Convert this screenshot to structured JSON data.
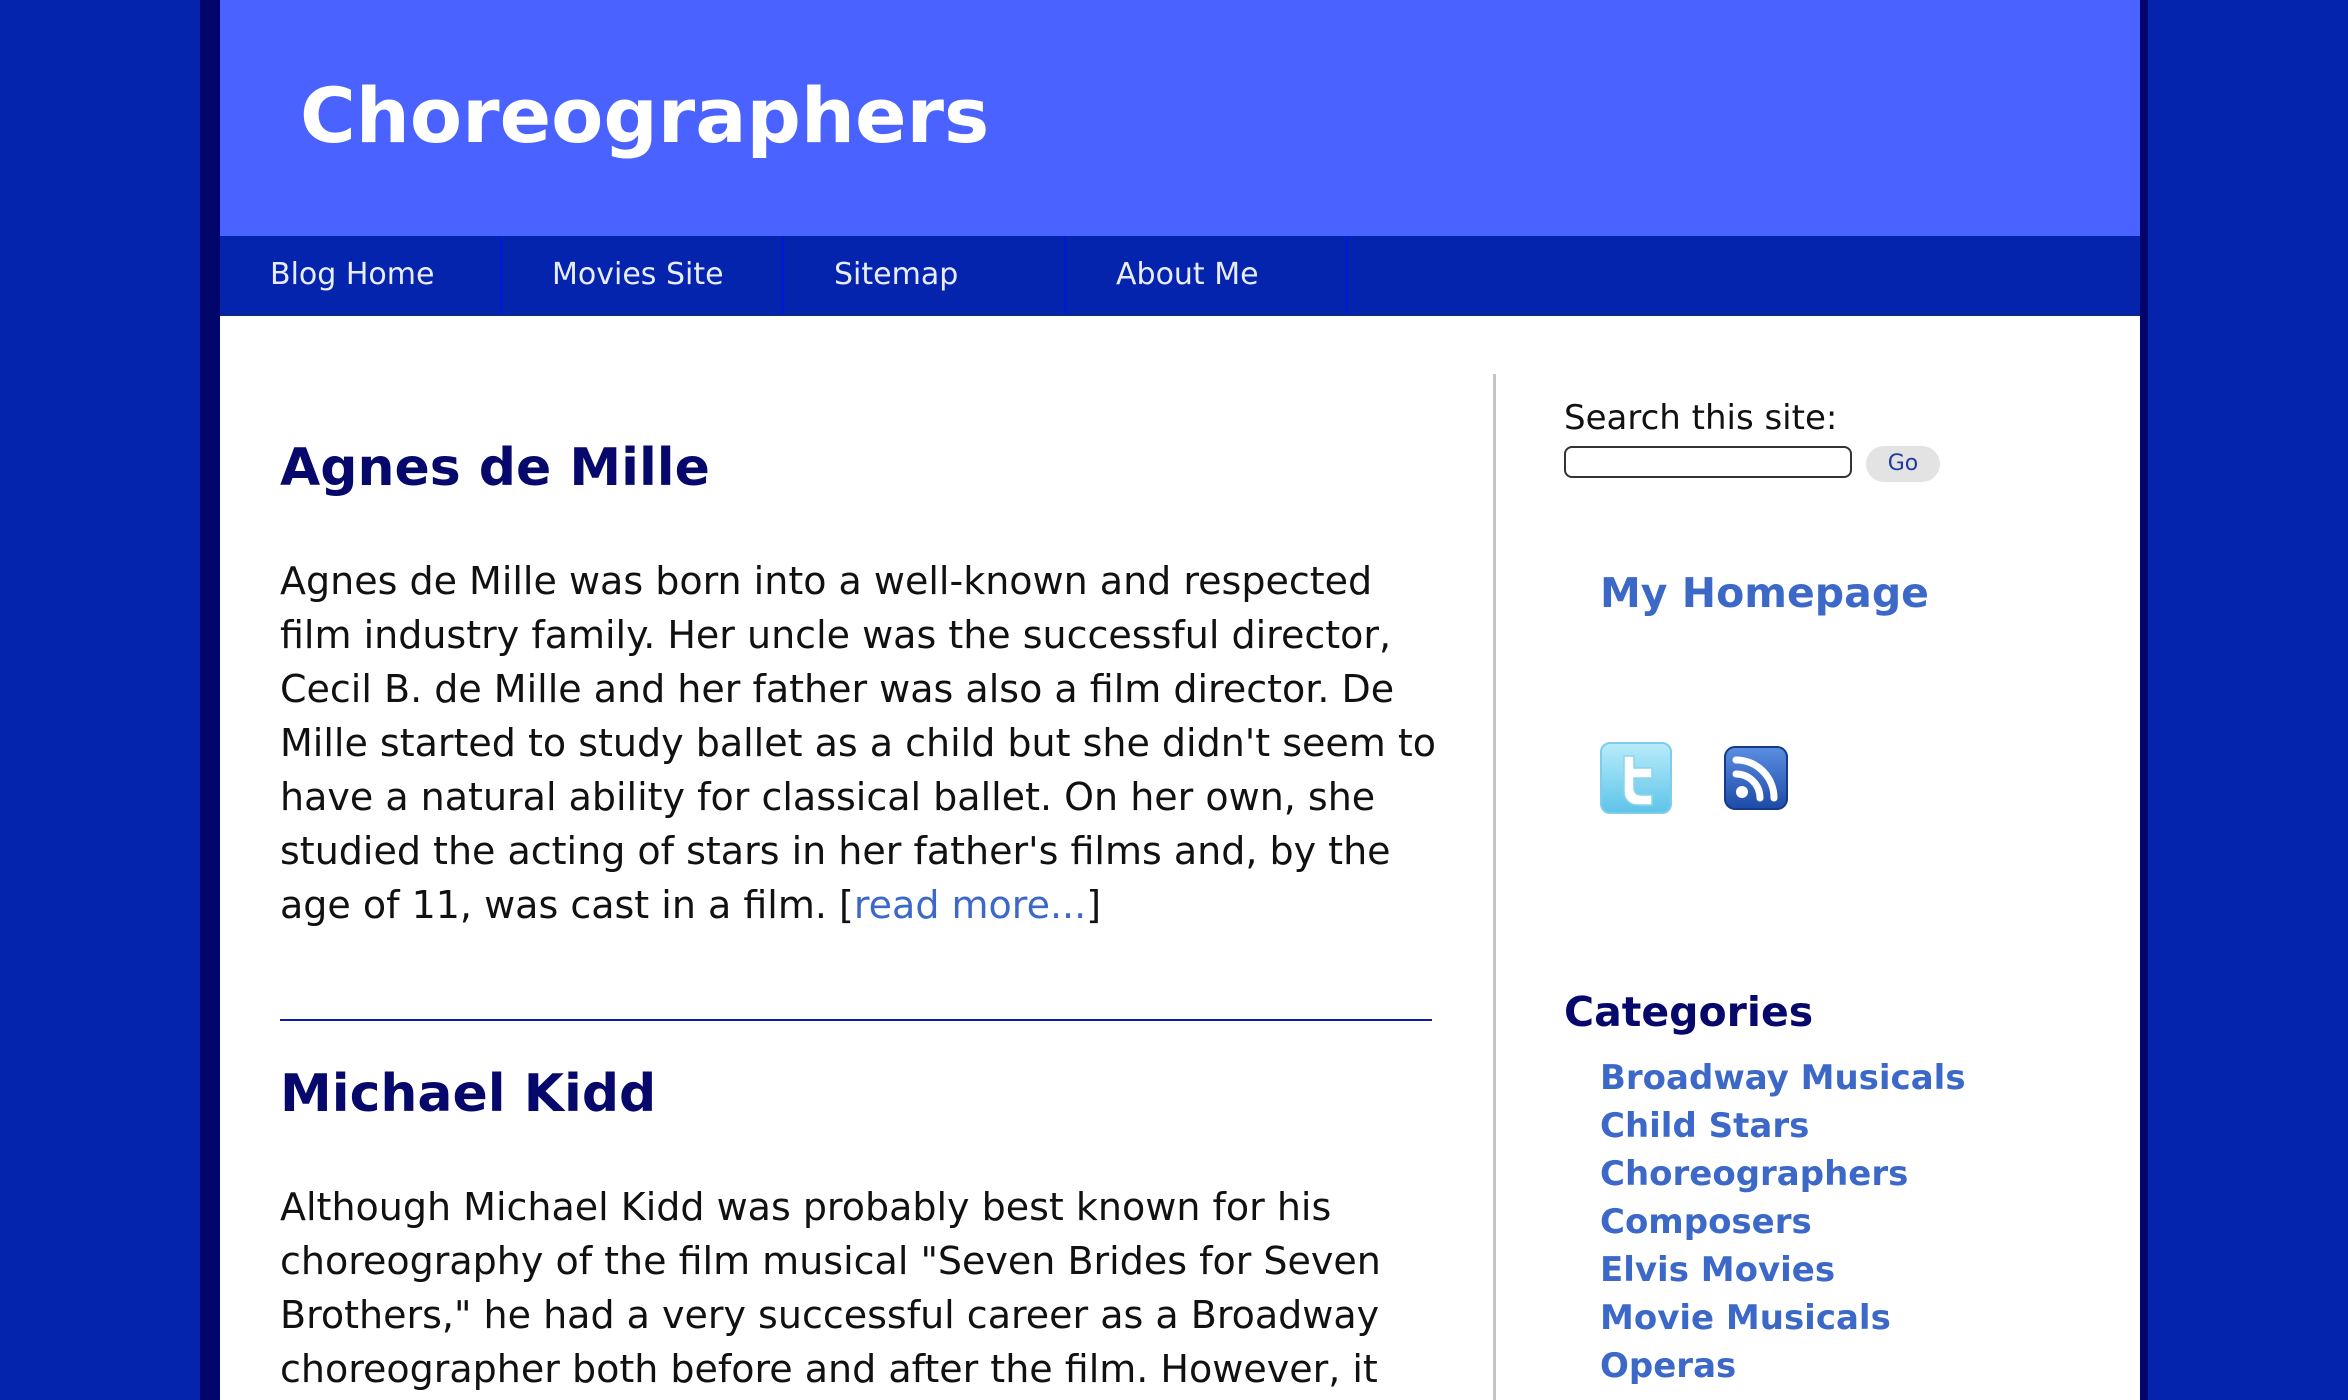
{
  "header": {
    "title": "Choreographers"
  },
  "nav": {
    "items": [
      {
        "label": "Blog Home"
      },
      {
        "label": "Movies Site"
      },
      {
        "label": "Sitemap"
      },
      {
        "label": "About Me"
      }
    ]
  },
  "posts": [
    {
      "title": "Agnes de Mille",
      "body": "Agnes de Mille was born into a well-known and respected film industry family. Her uncle was the successful director, Cecil B. de Mille and her father was also a film director. De Mille started to study ballet as a child but she didn't seem to have a natural ability for classical ballet. On her own, she studied the acting of stars in her father's films and, by the age of 11, was cast in a film. [",
      "read_more": "read more...",
      "close_bracket": "]"
    },
    {
      "title": "Michael Kidd",
      "body": "Although Michael Kidd was probably best known for his choreography of the film musical \"Seven Brides for Seven Brothers,\" he had a very successful career as a Broadway choreographer both before and after the film. However, it was"
    }
  ],
  "sidebar": {
    "search_label": "Search this site:",
    "search_value": "",
    "go_label": "Go",
    "homepage_label": "My Homepage",
    "icons": [
      "twitter-icon",
      "rss-icon"
    ],
    "categories_title": "Categories",
    "categories": [
      "Broadway Musicals",
      "Child Stars",
      "Choreographers",
      "Composers",
      "Elvis Movies",
      "Movie Musicals",
      "Operas"
    ]
  },
  "colors": {
    "background": "#0424ae",
    "header": "#4a62ff",
    "nav": "#0424ae",
    "heading": "#06086b",
    "link": "#3c68c8"
  }
}
